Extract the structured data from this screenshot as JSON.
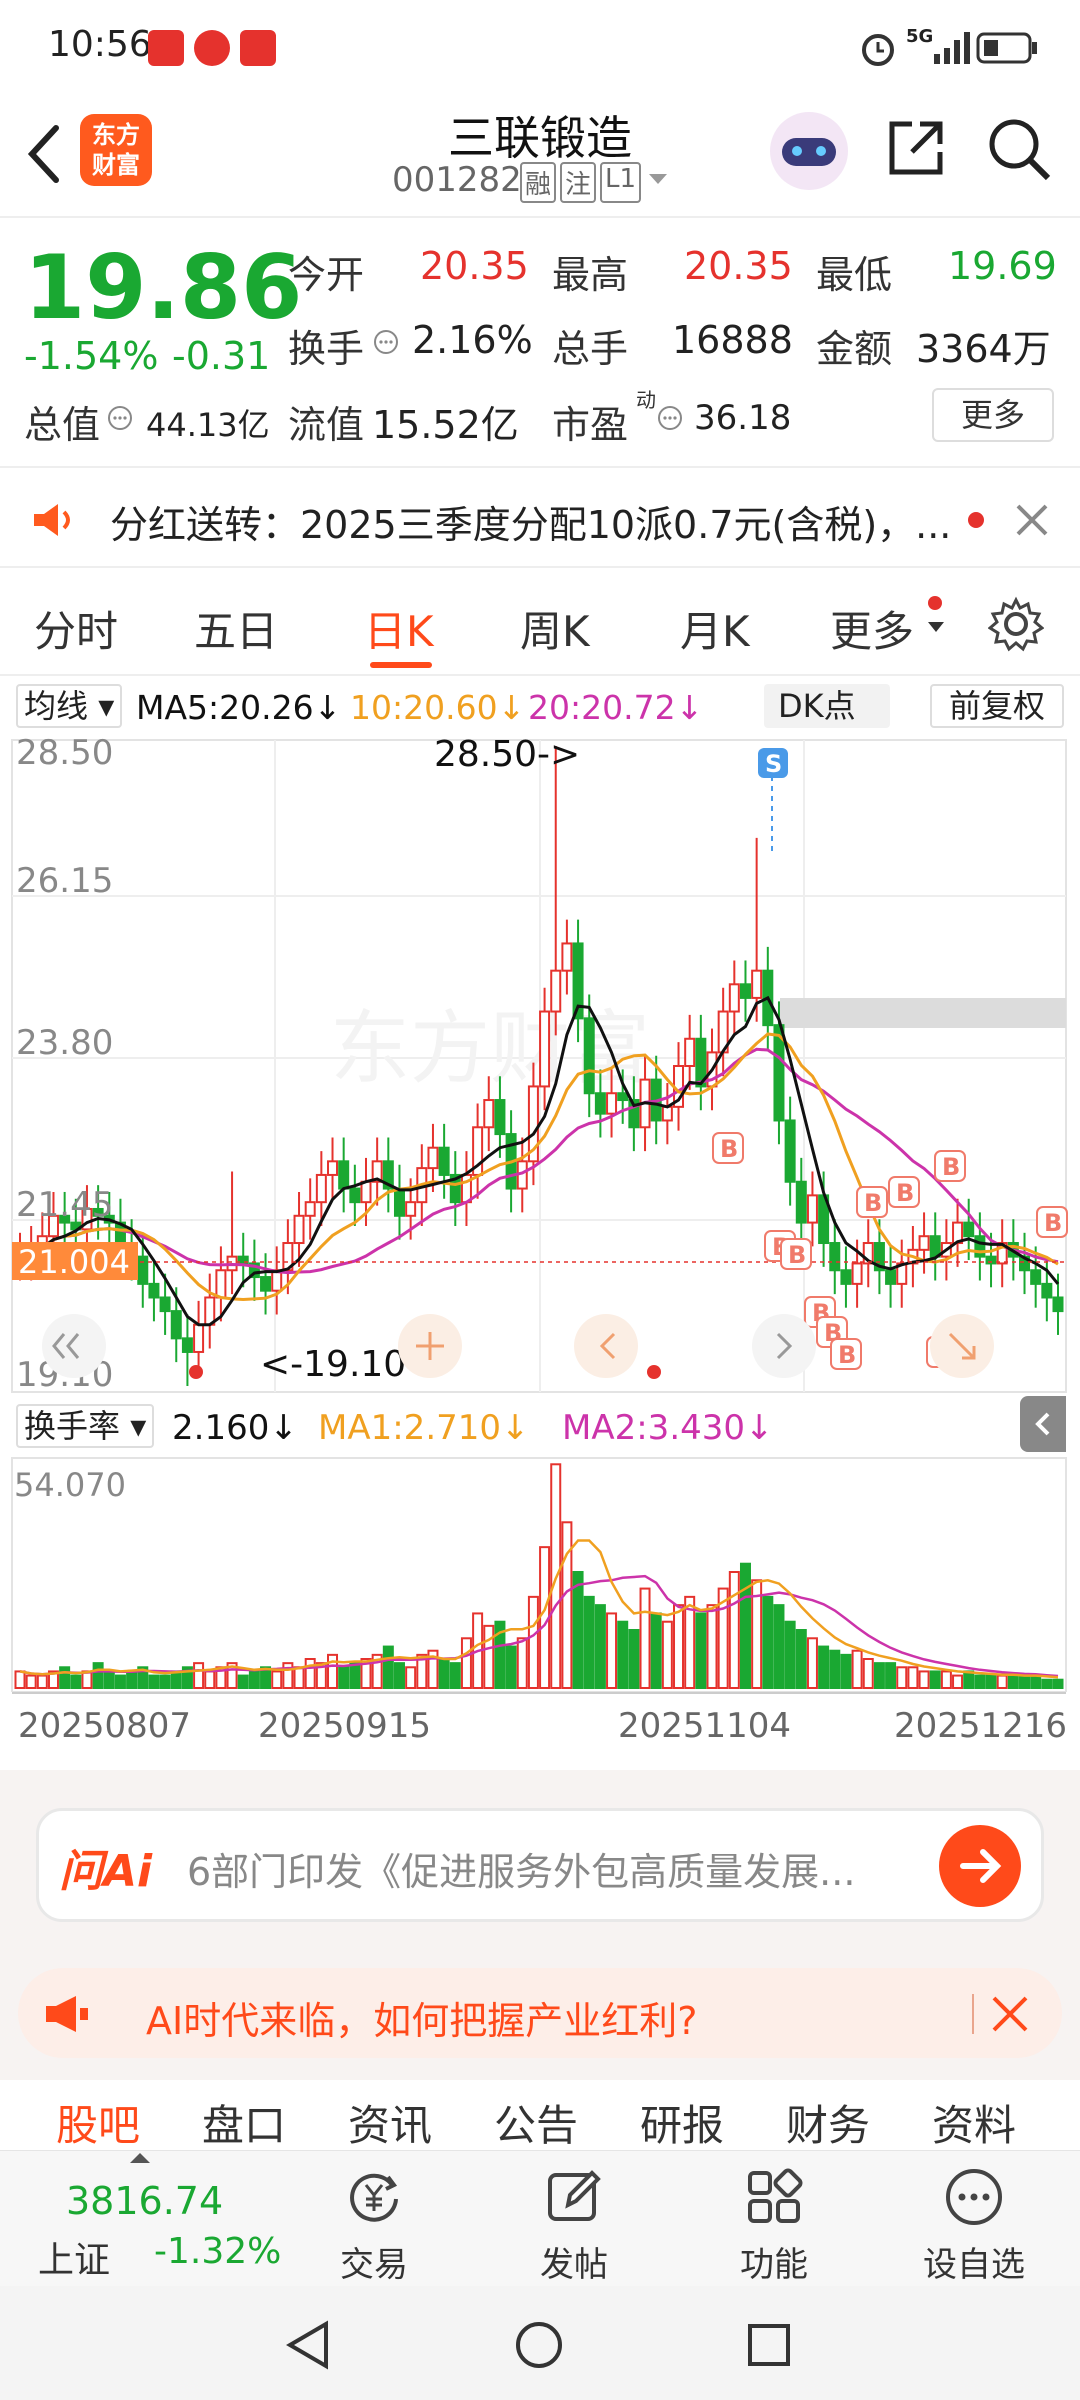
{
  "status": {
    "time": "10:56",
    "network": "5G"
  },
  "header": {
    "title": "三联锻造",
    "code": "001282",
    "tags": [
      "融",
      "注",
      "L1"
    ],
    "logo_line1": "东方",
    "logo_line2": "财富"
  },
  "quote": {
    "price": "19.86",
    "change_pct": "-1.54%",
    "change": "-0.31",
    "open_label": "今开",
    "open": "20.35",
    "high_label": "最高",
    "high": "20.35",
    "low_label": "最低",
    "low": "19.69",
    "turnover_label": "换手",
    "turnover": "2.16%",
    "volume_label": "总手",
    "volume": "16888",
    "amount_label": "金额",
    "amount": "3364万",
    "mktcap_label": "总值",
    "mktcap": "44.13亿",
    "float_label": "流值",
    "float": "15.52亿",
    "pe_label": "市盈",
    "pe_sup": "动",
    "pe": "36.18",
    "more": "更多"
  },
  "notice": {
    "text": "分红送转：2025三季度分配10派0.7元(含税)，..."
  },
  "tabs": [
    {
      "label": "分时",
      "active": false
    },
    {
      "label": "五日",
      "active": false
    },
    {
      "label": "日K",
      "active": true
    },
    {
      "label": "周K",
      "active": false
    },
    {
      "label": "月K",
      "active": false
    },
    {
      "label": "更多",
      "active": false
    }
  ],
  "ma_legend": {
    "selector": "均线",
    "ma5": "MA5:20.26↓",
    "ma10": "10:20.60↓",
    "ma20": "20:20.72↓",
    "dk": "DK点",
    "adjust": "前复权"
  },
  "kchart": {
    "y_labels": [
      "28.50",
      "26.15",
      "23.80",
      "21.45",
      "19.10"
    ],
    "current_line": "21.004",
    "high_note": "28.50->",
    "low_note": "<-19.10",
    "sell_marker": "S",
    "buy_marker": "B",
    "watermark": "东方财富"
  },
  "vol_legend": {
    "selector": "换手率",
    "value": "2.160↓",
    "ma1": "MA1:2.710↓",
    "ma2": "MA2:3.430↓"
  },
  "volchart": {
    "max_label": "54.070",
    "x_labels": [
      "20250807",
      "20250915",
      "20251104",
      "20251216"
    ]
  },
  "chart_data": {
    "type": "candlestick",
    "y_range": [
      19.1,
      28.5
    ],
    "current": 21.004,
    "high": 28.5,
    "low": 19.1,
    "x_labels": [
      "20250807",
      "20250915",
      "20251104",
      "20251216"
    ],
    "ma5_last": 20.26,
    "ma10_last": 20.6,
    "ma20_last": 20.72,
    "turnover_last": 2.16,
    "turnover_ma1": 2.71,
    "turnover_ma2": 3.43,
    "turnover_max": 54.07
  },
  "ai": {
    "brand": "问Ai",
    "text": "6部门印发《促进服务外包高质量发展..."
  },
  "promo": {
    "text": "AI时代来临，如何把握产业红利?"
  },
  "subtabs": [
    "股吧",
    "盘口",
    "资讯",
    "公告",
    "研报",
    "财务",
    "资料"
  ],
  "bottom": {
    "index_value": "3816.74",
    "index_name": "上证",
    "index_change": "-1.32%",
    "items": [
      "交易",
      "发帖",
      "功能",
      "设自选"
    ]
  },
  "colors": {
    "accent": "#ff4a1a",
    "up": "#e5322d",
    "down": "#1aa832",
    "ma5": "#111111",
    "ma10": "#f0a020",
    "ma20": "#cc33aa"
  }
}
